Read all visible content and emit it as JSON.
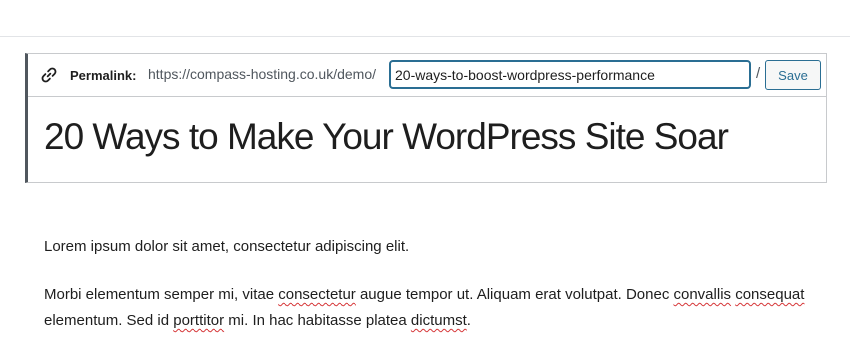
{
  "permalink": {
    "label": "Permalink:",
    "base_url": "https://compass-hosting.co.uk/demo/",
    "slug_value": "20-ways-to-boost-wordpress-performance",
    "slash": "/",
    "save_label": "Save",
    "icon": "link-icon"
  },
  "post": {
    "title": "20 Ways to Make Your WordPress Site Soar"
  },
  "content": {
    "paragraph1": "Lorem ipsum dolor sit amet, consectetur adipiscing elit.",
    "p2": {
      "s1": "Morbi elementum semper mi, vitae ",
      "w1": "consectetur",
      "s2": " augue tempor ut. Aliquam erat volutpat. Donec ",
      "w2": "convallis",
      "s3": " ",
      "w3": "consequat",
      "s4": " elementum. Sed id ",
      "w4": "porttitor",
      "s5": " mi. In hac habitasse platea ",
      "w5": "dictumst",
      "s6": "."
    }
  },
  "colors": {
    "focus_border": "#2a6e93",
    "spellcheck_underline": "#d63638",
    "title_left_border": "#50575e"
  }
}
